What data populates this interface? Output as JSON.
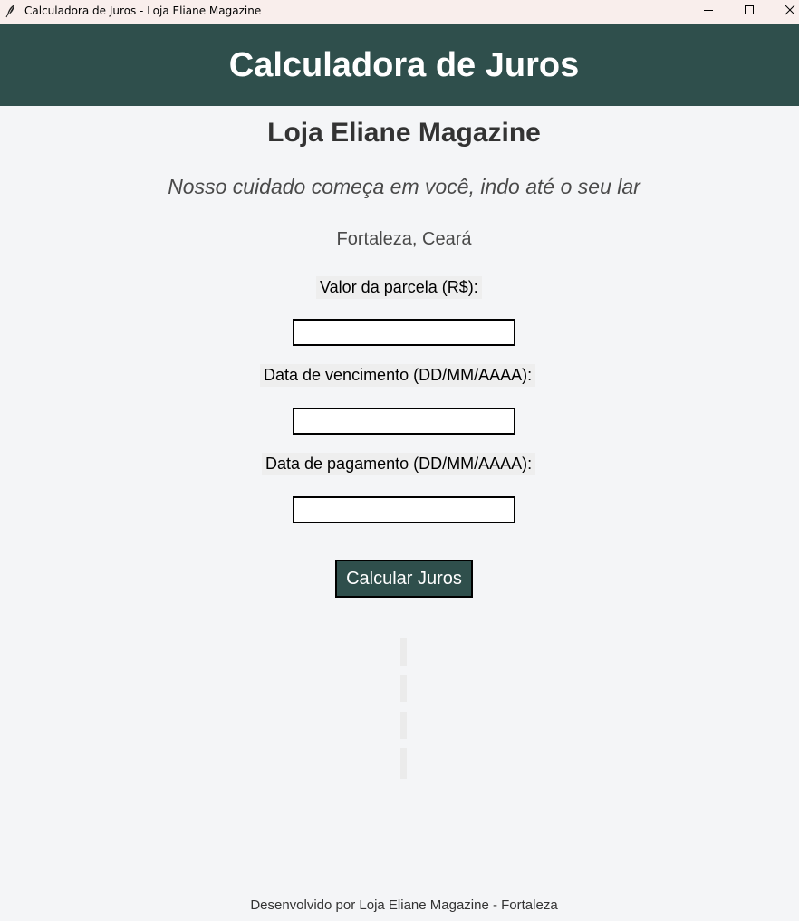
{
  "window": {
    "title": "Calculadora de Juros - Loja Eliane Magazine",
    "titlebar_color": "#f9eeec"
  },
  "header": {
    "title": "Calculadora de Juros",
    "background": "#2f4f4c"
  },
  "store": {
    "name": "Loja Eliane Magazine",
    "slogan": "Nosso cuidado começa em você, indo até o seu lar",
    "city": "Fortaleza, Ceará"
  },
  "form": {
    "installment_label": "Valor da parcela (R$):",
    "installment_value": "",
    "due_date_label": "Data de vencimento (DD/MM/AAAA):",
    "due_date_value": "",
    "payment_date_label": "Data de pagamento (DD/MM/AAAA):",
    "payment_date_value": "",
    "submit_label": "Calcular Juros"
  },
  "results": {
    "line1": "",
    "line2": "",
    "line3": "",
    "line4": ""
  },
  "footer": {
    "text": "Desenvolvido por Loja Eliane Magazine - Fortaleza"
  },
  "icons": {
    "app": "feather-icon",
    "minimize": "minimize-icon",
    "maximize": "maximize-icon",
    "close": "close-icon"
  }
}
